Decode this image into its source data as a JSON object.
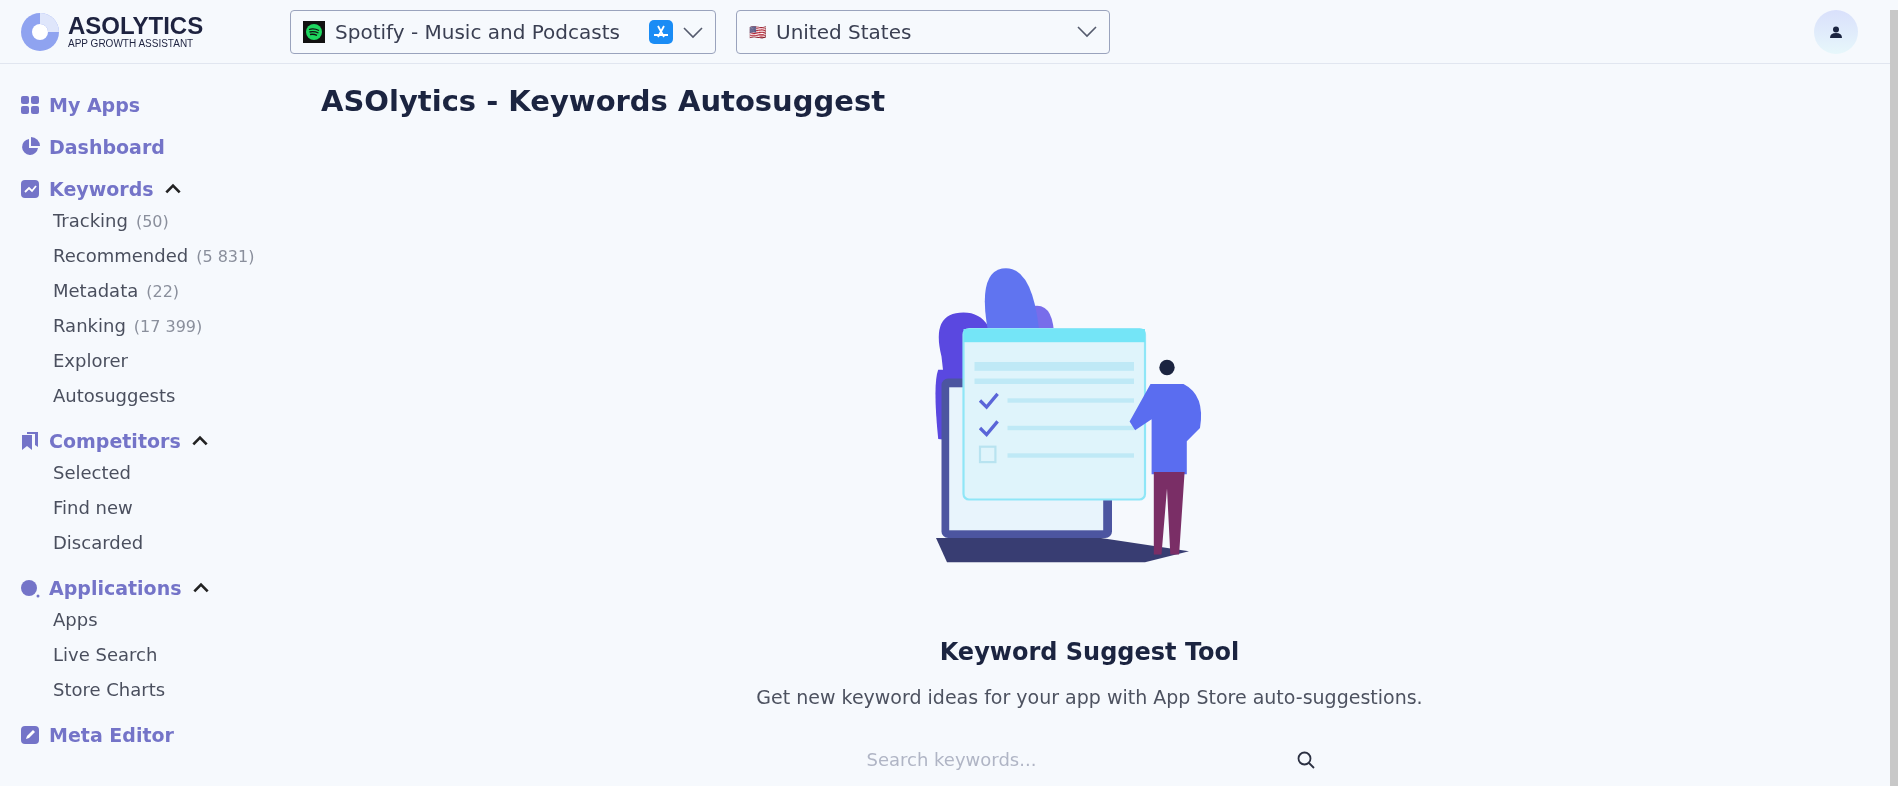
{
  "logo": {
    "name": "ASOLYTICS",
    "tagline": "APP GROWTH ASSISTANT"
  },
  "app_select": {
    "value": "Spotify - Music and Podcasts"
  },
  "country_select": {
    "flag": "🇺🇸",
    "value": "United States"
  },
  "sidebar": {
    "items": [
      {
        "label": "My Apps"
      },
      {
        "label": "Dashboard"
      },
      {
        "label": "Keywords",
        "expanded": true,
        "children": [
          {
            "label": "Tracking",
            "count": "(50)"
          },
          {
            "label": "Recommended",
            "count": "(5 831)"
          },
          {
            "label": "Metadata",
            "count": "(22)"
          },
          {
            "label": "Ranking",
            "count": "(17 399)"
          },
          {
            "label": "Explorer"
          },
          {
            "label": "Autosuggests"
          }
        ]
      },
      {
        "label": "Competitors",
        "expanded": true,
        "children": [
          {
            "label": "Selected"
          },
          {
            "label": "Find new"
          },
          {
            "label": "Discarded"
          }
        ]
      },
      {
        "label": "Applications",
        "expanded": true,
        "children": [
          {
            "label": "Apps"
          },
          {
            "label": "Live Search"
          },
          {
            "label": "Store Charts"
          }
        ]
      },
      {
        "label": "Meta Editor"
      }
    ]
  },
  "page": {
    "title": "ASOlytics - Keywords Autosuggest",
    "empty_title": "Keyword Suggest Tool",
    "empty_text": "Get new keyword ideas for your app with App Store auto-suggestions.",
    "search": {
      "placeholder": "Search keywords..."
    }
  }
}
